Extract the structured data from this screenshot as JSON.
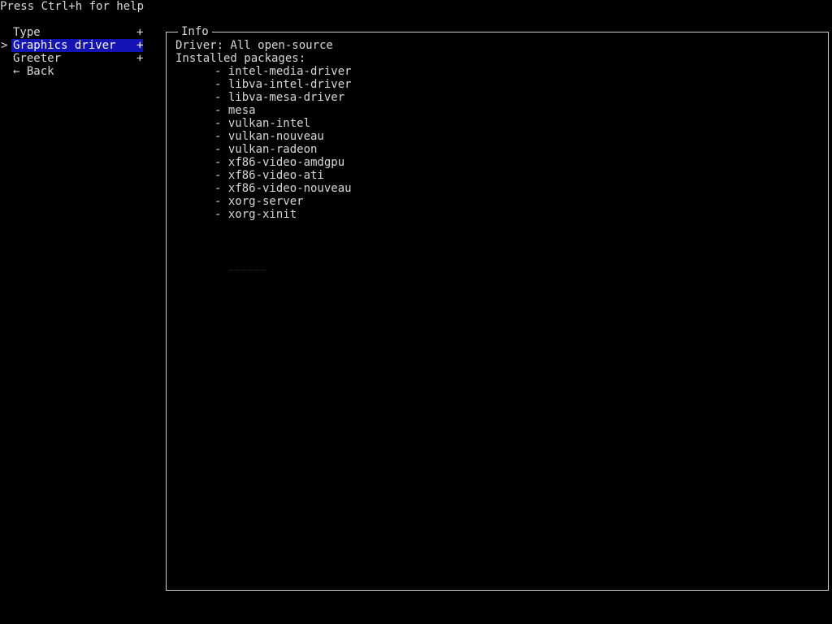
{
  "help_text": "Press Ctrl+h for help",
  "menu": {
    "cursor_glyph": ">",
    "items": [
      {
        "label": "Type",
        "suffix": "+",
        "selected": false
      },
      {
        "label": "Graphics driver",
        "suffix": "+",
        "selected": true
      },
      {
        "label": "Greeter",
        "suffix": "+",
        "selected": false
      },
      {
        "label": "← Back",
        "suffix": "",
        "selected": false
      }
    ]
  },
  "info": {
    "title": "Info",
    "driver_line": "Driver: All open-source",
    "installed_label": "Installed packages:",
    "packages": [
      "- intel-media-driver",
      "- libva-intel-driver",
      "- libva-mesa-driver",
      "- mesa",
      "- vulkan-intel",
      "- vulkan-nouveau",
      "- vulkan-radeon",
      "- xf86-video-amdgpu",
      "- xf86-video-ati",
      "- xf86-video-nouveau",
      "- xorg-server",
      "- xorg-xinit"
    ]
  },
  "colors": {
    "background": "#000000",
    "text": "#d8d8d8",
    "selection_bg": "#1414b4",
    "border": "#cfcfcf"
  }
}
